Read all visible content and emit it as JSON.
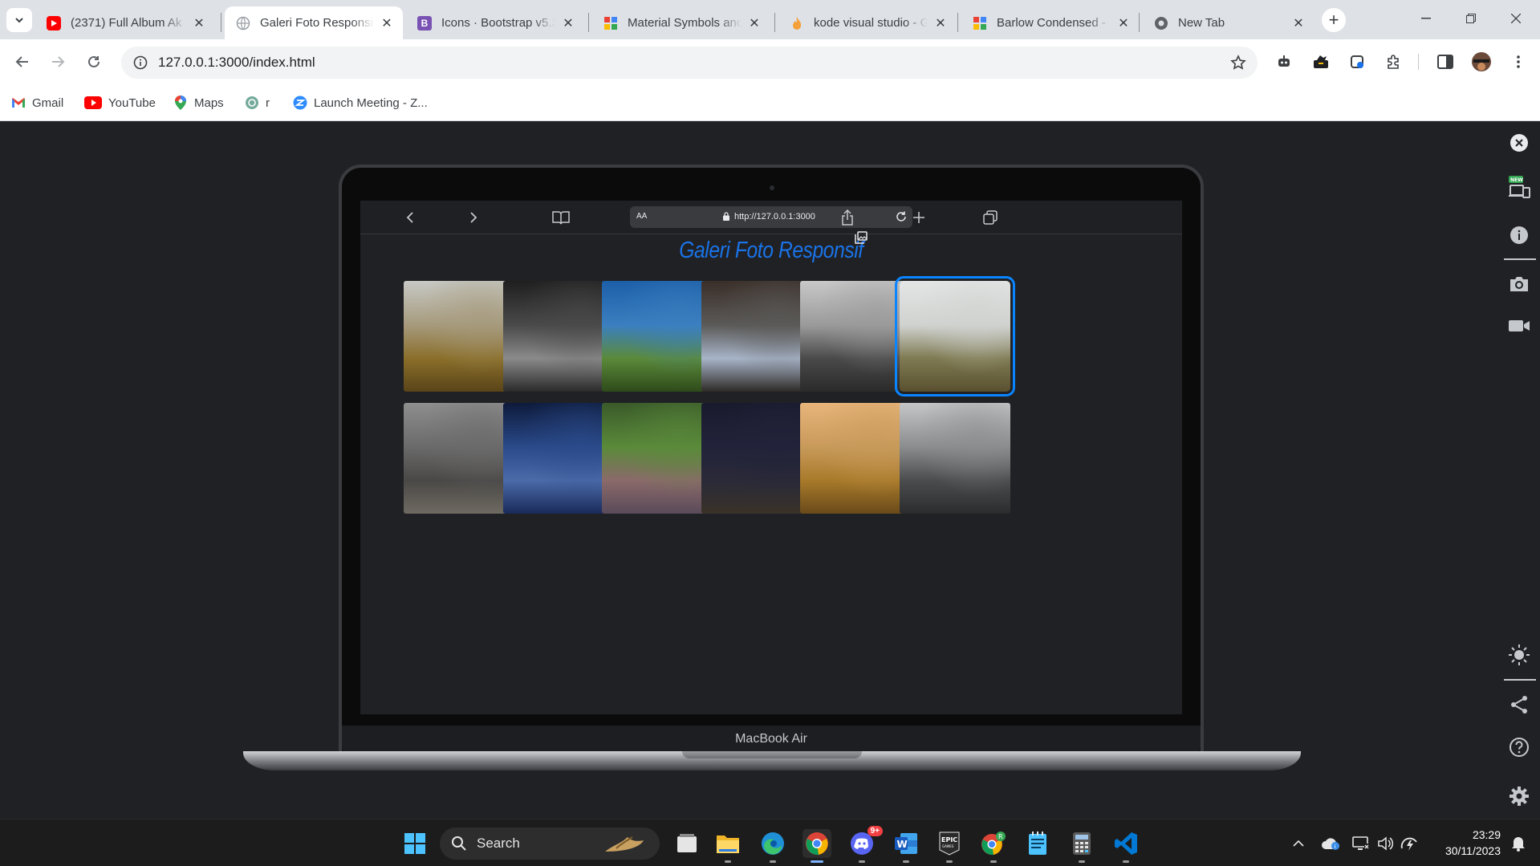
{
  "browser": {
    "tabs": [
      {
        "title": "(2371) Full Album Ak",
        "favicon": "youtube-icon",
        "active": false
      },
      {
        "title": "Galeri Foto Responsif",
        "favicon": "globe-icon",
        "active": true
      },
      {
        "title": "Icons · Bootstrap v5.3",
        "favicon": "bootstrap-icon",
        "active": false
      },
      {
        "title": "Material Symbols anc",
        "favicon": "material-icon",
        "active": false
      },
      {
        "title": "kode visual studio - G",
        "favicon": "fire-icon",
        "active": false
      },
      {
        "title": "Barlow Condensed -",
        "favicon": "google-fonts-icon",
        "active": false
      },
      {
        "title": "New Tab",
        "favicon": "chrome-icon",
        "active": false
      }
    ],
    "address": "127.0.0.1:3000/index.html",
    "bookmarks": [
      {
        "label": "Gmail",
        "icon": "gmail-icon"
      },
      {
        "label": "YouTube",
        "icon": "youtube-icon"
      },
      {
        "label": "Maps",
        "icon": "maps-icon"
      },
      {
        "label": "r",
        "icon": "chatgpt-icon"
      },
      {
        "label": "Launch Meeting - Z...",
        "icon": "zoom-icon"
      }
    ]
  },
  "device": {
    "label": "MacBook Air",
    "safari": {
      "aa": "AA",
      "url": "http://127.0.0.1:3000"
    }
  },
  "gallery": {
    "title": "Galeri Foto Responsif",
    "photos": [
      {
        "desc": "wheat-field",
        "colors": [
          "#c7c9c5",
          "#a69a7c",
          "#8a6e2a",
          "#5a4418"
        ]
      },
      {
        "desc": "forest-road",
        "colors": [
          "#1f1f1f",
          "#4a4a4a",
          "#8a8a8a",
          "#2a2a2a"
        ]
      },
      {
        "desc": "green-hill-blue-sky",
        "colors": [
          "#1c5fa8",
          "#3b7fc0",
          "#5b8a3a",
          "#2e4a1a"
        ]
      },
      {
        "desc": "woman-reading",
        "colors": [
          "#3a2e28",
          "#5b5a58",
          "#a7b4c8",
          "#2e2a26"
        ]
      },
      {
        "desc": "mountain-valley-bw",
        "colors": [
          "#c8c8c8",
          "#9a9a9a",
          "#4a4a4a",
          "#2a2a2a"
        ]
      },
      {
        "desc": "foggy-slope",
        "colors": [
          "#e4e6e6",
          "#d0d2d0",
          "#7e7a52",
          "#5a5030"
        ],
        "selected": true
      },
      {
        "desc": "woman-window",
        "colors": [
          "#8e8e8e",
          "#6a6a6a",
          "#4a4846",
          "#6e6a62"
        ]
      },
      {
        "desc": "night-sky-stars",
        "colors": [
          "#0d1a3a",
          "#2a4a8a",
          "#4a6aa8",
          "#1a2a5a"
        ]
      },
      {
        "desc": "tree-tunnel",
        "colors": [
          "#3a5a2a",
          "#5a8a3a",
          "#8a6a6a",
          "#5a4a5a"
        ]
      },
      {
        "desc": "dark-night-field",
        "colors": [
          "#1a1a2e",
          "#22223a",
          "#2a2a38",
          "#3a3228"
        ]
      },
      {
        "desc": "balloons-canyon",
        "colors": [
          "#e8b47a",
          "#c89a5a",
          "#a87a2a",
          "#6a4a1a"
        ]
      },
      {
        "desc": "street-buildings",
        "colors": [
          "#c4c6c8",
          "#8a8c8e",
          "#4a4c4e",
          "#2a2c2e"
        ]
      }
    ]
  },
  "taskbar": {
    "search_label": "Search",
    "time": "23:29",
    "date": "30/11/2023",
    "apps": [
      "windows-start-icon",
      "task-view-icon",
      "file-explorer-icon",
      "edge-icon",
      "chrome-icon",
      "discord-icon",
      "word-icon",
      "epic-games-icon",
      "chrome-profile-icon",
      "notepad-icon",
      "calculator-icon",
      "vscode-icon"
    ],
    "discord_badge": "9+"
  },
  "colors": {
    "accent": "#1a73e8",
    "selected_outline": "#0a84ff",
    "page_bg": "#202124"
  }
}
